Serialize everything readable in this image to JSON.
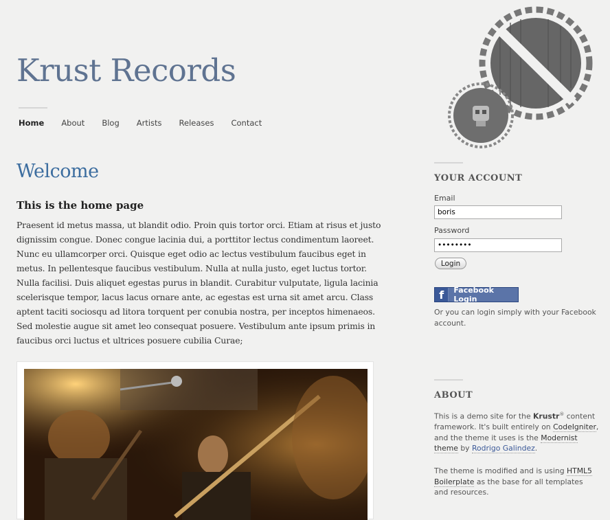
{
  "site": {
    "title": "Krust Records"
  },
  "nav": {
    "items": [
      "Home",
      "About",
      "Blog",
      "Artists",
      "Releases",
      "Contact"
    ],
    "active": "Home"
  },
  "main": {
    "heading": "Welcome",
    "subheading": "This is the home page",
    "body": "Praesent id metus massa, ut blandit odio. Proin quis tortor orci. Etiam at risus et justo dignissim congue. Donec congue lacinia dui, a porttitor lectus condimentum laoreet. Nunc eu ullamcorper orci. Quisque eget odio ac lectus vestibulum faucibus eget in metus. In pellentesque faucibus vestibulum. Nulla at nulla justo, eget luctus tortor. Nulla facilisi. Duis aliquet egestas purus in blandit. Curabitur vulputate, ligula lacinia scelerisque tempor, lacus lacus ornare ante, ac egestas est urna sit amet arcu. Class aptent taciti sociosqu ad litora torquent per conubia nostra, per inceptos himenaeos. Sed molestie augue sit amet leo consequat posuere. Vestibulum ante ipsum primis in faucibus orci luctus et ultrices posuere cubilia Curae;",
    "photo_icon": "band-live-photo"
  },
  "account": {
    "heading": "YOUR ACCOUNT",
    "email_label": "Email",
    "email_value": "boris",
    "password_label": "Password",
    "password_value": "password",
    "login_label": "Login",
    "facebook_icon": "facebook-f",
    "facebook_label": "Facebook Login",
    "facebook_note": "Or you can login simply with your Facebook account."
  },
  "about": {
    "heading": "ABOUT",
    "p1_prefix": "This is a demo site for the ",
    "p1_brand": "Krustr",
    "p1_reg": "®",
    "p1_mid": " content framework. It's built entirely on ",
    "p1_ci": "CodeIgniter",
    "p1_mid2": ", and the theme it uses is the ",
    "p1_theme": "Modernist theme",
    "p1_by": " by ",
    "p1_author": "Rodrigo Galindez",
    "p1_end": ".",
    "p2_prefix": "The theme is modified and is using ",
    "p2_link": "HTML5 Boilerplate",
    "p2_end": " as the base for all templates and resources."
  },
  "colors": {
    "title": "#5f7391",
    "heading": "#3c6d9f",
    "facebook": "#3b5998",
    "background": "#f1f1f0"
  }
}
